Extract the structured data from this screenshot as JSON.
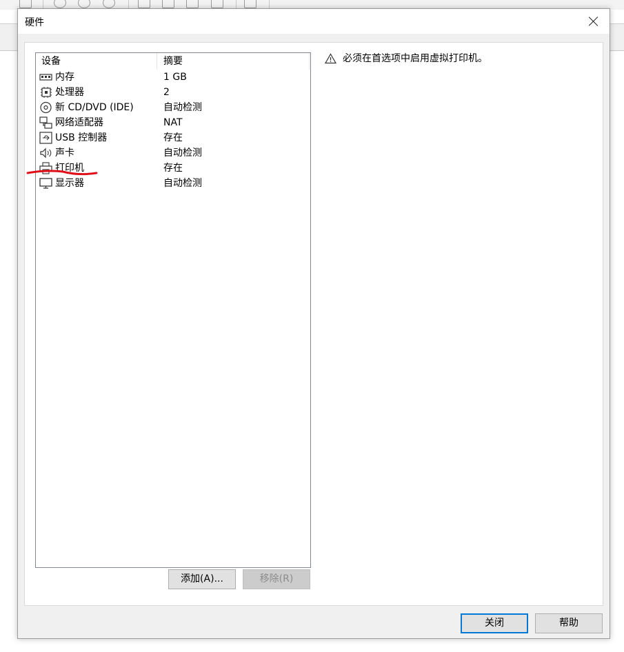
{
  "dialog": {
    "title": "硬件"
  },
  "device_list": {
    "columns": [
      "设备",
      "摘要"
    ],
    "rows": [
      {
        "name": "内存",
        "summary": "1 GB",
        "icon": "memory-icon"
      },
      {
        "name": "处理器",
        "summary": "2",
        "icon": "processor-icon"
      },
      {
        "name": "新 CD/DVD (IDE)",
        "summary": "自动检测",
        "icon": "cd-dvd-icon"
      },
      {
        "name": "网络适配器",
        "summary": "NAT",
        "icon": "network-adapter-icon"
      },
      {
        "name": "USB 控制器",
        "summary": "存在",
        "icon": "usb-icon"
      },
      {
        "name": "声卡",
        "summary": "自动检测",
        "icon": "sound-card-icon"
      },
      {
        "name": "打印机",
        "summary": "存在",
        "icon": "printer-icon"
      },
      {
        "name": "显示器",
        "summary": "自动检测",
        "icon": "display-icon"
      }
    ]
  },
  "buttons": {
    "add": "添加(A)...",
    "remove": "移除(R)",
    "close": "关闭",
    "help": "帮助"
  },
  "detail": {
    "warning": "必须在首选项中启用虚拟打印机。"
  },
  "colors": {
    "annotation": "#e0101a",
    "focus_border": "#0078d7"
  }
}
